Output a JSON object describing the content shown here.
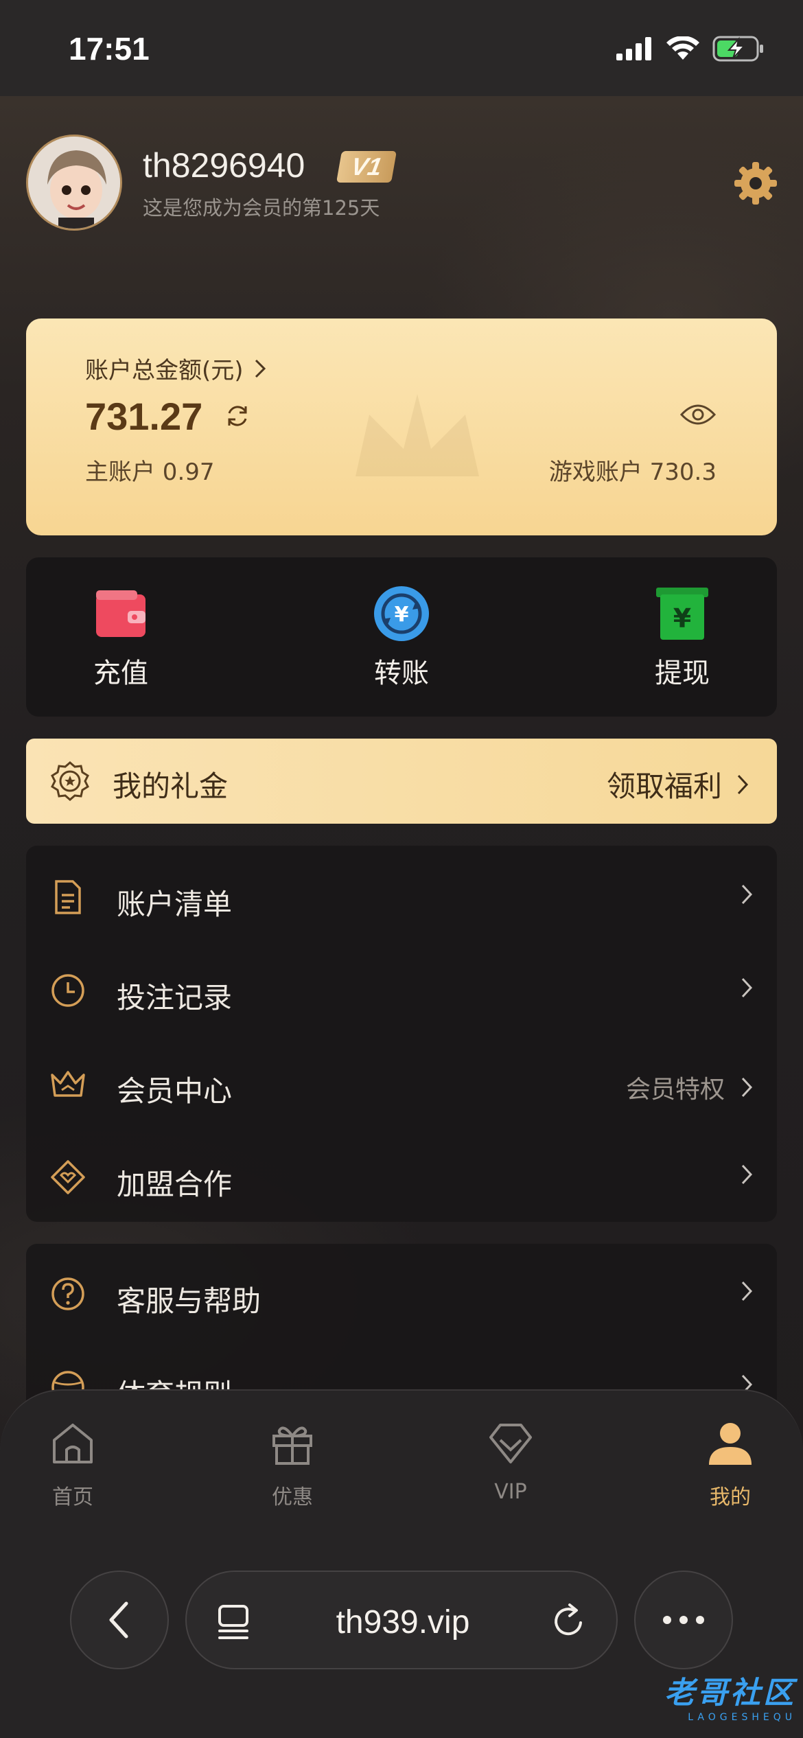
{
  "status_bar": {
    "time": "17:51"
  },
  "profile": {
    "username": "th8296940",
    "vip_level": "V1",
    "member_days": "这是您成为会员的第125天"
  },
  "balance": {
    "title": "账户总金额(元)",
    "amount": "731.27",
    "main_account": "主账户 0.97",
    "game_account": "游戏账户 730.3"
  },
  "actions": [
    {
      "label": "充值",
      "icon": "wallet-icon",
      "color": "#ee4a5f"
    },
    {
      "label": "转账",
      "icon": "transfer-icon",
      "color": "#3a9be8"
    },
    {
      "label": "提现",
      "icon": "withdraw-icon",
      "color": "#22b33c"
    }
  ],
  "gift": {
    "label": "我的礼金",
    "action": "领取福利"
  },
  "menu_group_1": [
    {
      "label": "账户清单",
      "icon": "document-icon",
      "extra": ""
    },
    {
      "label": "投注记录",
      "icon": "clock-icon",
      "extra": ""
    },
    {
      "label": "会员中心",
      "icon": "crown-icon",
      "extra": "会员特权"
    },
    {
      "label": "加盟合作",
      "icon": "diamond-icon",
      "extra": ""
    }
  ],
  "menu_group_2": [
    {
      "label": "客服与帮助",
      "icon": "help-icon",
      "extra": ""
    },
    {
      "label": "体育规则",
      "icon": "ball-icon",
      "extra": ""
    }
  ],
  "tabs": [
    {
      "label": "首页",
      "icon": "home-icon",
      "active": false
    },
    {
      "label": "优惠",
      "icon": "gift-icon",
      "active": false
    },
    {
      "label": "VIP",
      "icon": "vip-diamond-icon",
      "active": false
    },
    {
      "label": "我的",
      "icon": "user-icon",
      "active": true
    }
  ],
  "browser": {
    "url": "th939.vip"
  },
  "watermark": {
    "title": "老哥社区",
    "subtitle": "LAOGESHEQU"
  },
  "colors": {
    "accent_gold": "#e8b86a",
    "card_gold": "#f7d592",
    "background": "#1d1b1c"
  }
}
